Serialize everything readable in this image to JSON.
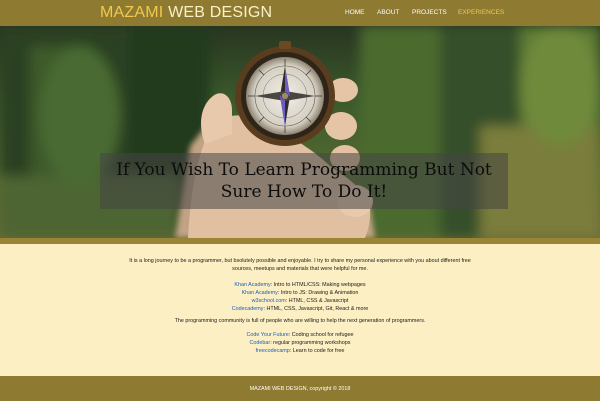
{
  "header": {
    "brand_part1": "MAZAMI",
    "brand_part2": "WEB DESIGN",
    "nav": [
      "HOME",
      "ABOUT",
      "PROJECTS",
      "EXPERIENCES"
    ],
    "active_nav": "EXPERIENCES"
  },
  "hero": {
    "tagline": "If You Wish To Learn Programming But Not Sure How To Do It!"
  },
  "content": {
    "intro": "It is a long journey to be a programmer, but bsolutely possible and enjoyable. I try to share my personal experience with you about different free sources, meetups and materials that were helpful for me.",
    "learning_resources": [
      {
        "name": "Khan Academy",
        "desc": ": Intro to HTML/CSS: Making webpages"
      },
      {
        "name": "Khan Academy",
        "desc": ": Intro to JS: Drawing & Animation"
      },
      {
        "name": "w3school.com",
        "desc": ": HTML, CSS & Javascript"
      },
      {
        "name": "Codecademy",
        "desc": ": HTML, CSS, Javascript, Git, React & more"
      }
    ],
    "community_text": "The programming community is full of people who are willing to help the next generation of programmers.",
    "community_resources": [
      {
        "name": "Code Your Future",
        "desc": ": Coding school for refugee"
      },
      {
        "name": "Codebar",
        "desc": ": regular programming workshops"
      },
      {
        "name": "freecodecamp",
        "desc": ": Learn to code for free"
      }
    ]
  },
  "footer": {
    "text": "MAZAMI WEB DESIGN, copyright © 2018"
  },
  "colors": {
    "header_bg": "#8e7a30",
    "brand_accent": "#f2c94c",
    "page_bg": "#fcefc3",
    "link": "#1f5eb8"
  }
}
